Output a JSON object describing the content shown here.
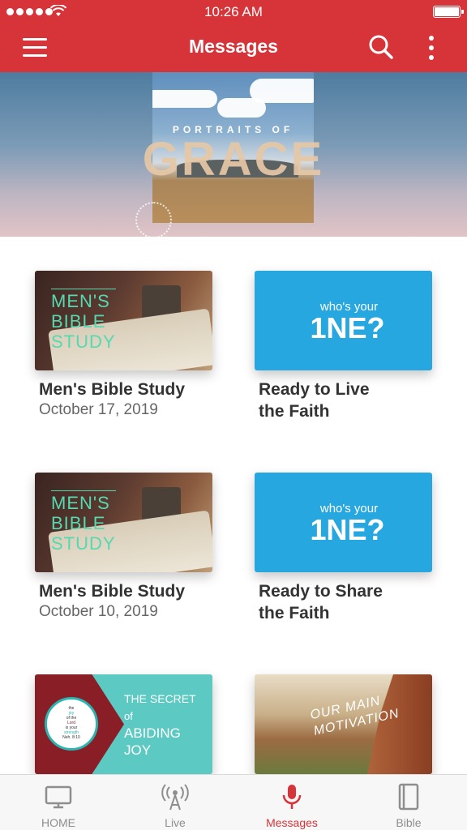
{
  "status_bar": {
    "time": "10:26 AM"
  },
  "header": {
    "title": "Messages",
    "menu_icon": "hamburger-icon",
    "search_icon": "search-icon",
    "more_icon": "more-vertical-icon"
  },
  "hero": {
    "subtitle": "PORTRAITS OF",
    "title": "GRACE"
  },
  "messages": [
    {
      "title": "Men's Bible Study",
      "date": "October 17, 2019",
      "thumb_text": [
        "MEN'S",
        "BIBLE",
        "STUDY"
      ]
    },
    {
      "title": "Ready to Live the Faith",
      "date": "",
      "thumb_small": "who's your",
      "thumb_big": "1NE?"
    },
    {
      "title": "Men's Bible Study",
      "date": "October 10, 2019",
      "thumb_text": [
        "MEN'S",
        "BIBLE",
        "STUDY"
      ]
    },
    {
      "title": "Ready to Share the Faith",
      "date": "",
      "thumb_small": "who's your",
      "thumb_big": "1NE?"
    },
    {
      "title": "",
      "date": "",
      "thumb_text": [
        "THE SECRET",
        "of",
        "ABIDING",
        "JOY"
      ],
      "badge_text": [
        "the",
        "joy",
        "of the",
        "Lord",
        "is your",
        "strength",
        "Neh. 8:10"
      ]
    },
    {
      "title": "",
      "date": "",
      "thumb_text": [
        "OUR MAIN",
        "MOTIVATION"
      ]
    }
  ],
  "tabs": [
    {
      "label": "HOME",
      "icon": "tv-icon",
      "active": false
    },
    {
      "label": "Live",
      "icon": "broadcast-icon",
      "active": false
    },
    {
      "label": "Messages",
      "icon": "microphone-icon",
      "active": true
    },
    {
      "label": "Bible",
      "icon": "book-icon",
      "active": false
    }
  ],
  "colors": {
    "brand": "#d7343a",
    "tab_inactive": "#8e8e8e",
    "one_blue": "#27a7e0"
  }
}
